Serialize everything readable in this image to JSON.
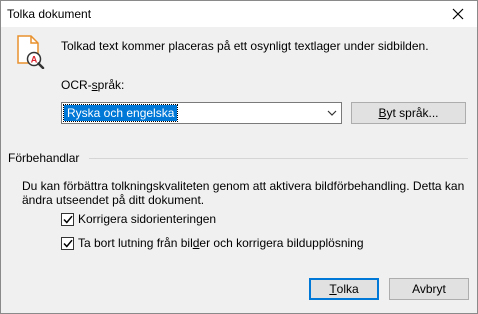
{
  "window": {
    "title": "Tolka dokument"
  },
  "main": {
    "intro": "Tolkad text kommer placeras på ett osynligt textlager under sidbilden.",
    "ocr_label": {
      "pre": "OCR-",
      "u": "s",
      "post": "pråk:"
    },
    "ocr_language_value": "Ryska och engelska",
    "change_language_button": {
      "pre": "",
      "u": "B",
      "post": "yt språk..."
    }
  },
  "preprocessing": {
    "group_title": "Förbehandlar",
    "description": "Du kan förbättra tolkningskvaliteten genom att aktivera bildförbehandling. Detta kan ändra utseendet på ditt dokument.",
    "checkbox_orientation": {
      "checked": true,
      "pre": "Korri",
      "u": "g",
      "post": "era sidorienteringen"
    },
    "checkbox_deskew": {
      "checked": true,
      "pre": "Ta bort lutning från bil",
      "u": "d",
      "post": "er och korrigera bildupplösning"
    }
  },
  "footer": {
    "ok_button": {
      "pre": "",
      "u": "T",
      "post": "olka"
    },
    "cancel_button": "Avbryt"
  },
  "colors": {
    "accent": "#0078d7",
    "icon_orange": "#e8912d",
    "icon_red": "#d9232d"
  },
  "icons": {
    "close": "close-icon",
    "document": "document-ocr-icon",
    "dropdown": "chevron-down-icon",
    "check": "checkmark-icon"
  }
}
